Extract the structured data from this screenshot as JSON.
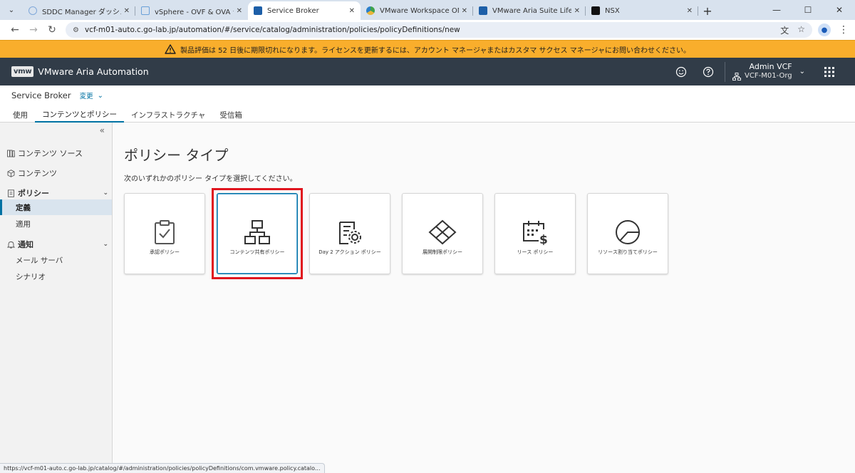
{
  "browser": {
    "tabs": [
      {
        "label": "SDDC Manager ダッシュボード",
        "favicon_color": "#7fa7d9"
      },
      {
        "label": "vSphere - OVF & OVA テンプレー",
        "favicon_color": "#6aa0d8"
      },
      {
        "label": "Service Broker",
        "favicon_color": "#1d5fa8"
      },
      {
        "label": "VMware Workspace ONE",
        "favicon_color": "#3fa34d"
      },
      {
        "label": "VMware Aria Suite Lifecycle",
        "favicon_color": "#1d5fa8"
      },
      {
        "label": "NSX",
        "favicon_color": "#111111"
      }
    ],
    "active_tab_index": 2,
    "url": "vcf-m01-auto.c.go-lab.jp/automation/#/service/catalog/administration/policies/policyDefinitions/new"
  },
  "banner": {
    "text": "製品評価は 52 日後に期限切れになります。ライセンスを更新するには、アカウント マネージャまたはカスタマ サクセス マネージャにお問い合わせください。",
    "color": "#f9ae2c"
  },
  "header": {
    "logo": "vmw",
    "title": "VMware Aria Automation",
    "user_name": "Admin VCF",
    "org_name": "VCF-M01-Org",
    "bg_color": "#313c48"
  },
  "service": {
    "title": "Service Broker",
    "change_label": "変更",
    "tabs": [
      {
        "label": "使用"
      },
      {
        "label": "コンテンツとポリシー"
      },
      {
        "label": "インフラストラクチャ"
      },
      {
        "label": "受信箱"
      }
    ],
    "active_tab_index": 1
  },
  "sidebar": {
    "content_sources": "コンテンツ ソース",
    "content": "コンテンツ",
    "policy": "ポリシー",
    "policy_definitions": "定義",
    "policy_enforcement": "適用",
    "notifications": "通知",
    "mail_server": "メール サーバ",
    "scenarios": "シナリオ"
  },
  "main": {
    "title": "ポリシー タイプ",
    "description": "次のいずれかのポリシー タイプを選択してください。",
    "cards": [
      {
        "label": "承認ポリシー",
        "icon": "clipboard-check-icon"
      },
      {
        "label": "コンテンツ共有ポリシー",
        "icon": "network-share-icon"
      },
      {
        "label": "Day 2 アクション ポリシー",
        "icon": "document-gear-icon"
      },
      {
        "label": "展開制限ポリシー",
        "icon": "diamond-grid-icon"
      },
      {
        "label": "リース ポリシー",
        "icon": "calendar-dollar-icon"
      },
      {
        "label": "リソース割り当てポリシー",
        "icon": "pie-icon"
      }
    ],
    "selected_card_index": 1
  },
  "status": {
    "url": "https://vcf-m01-auto.c.go-lab.jp/catalog/#/administration/policies/policyDefinitions/com.vmware.policy.catalo..."
  }
}
